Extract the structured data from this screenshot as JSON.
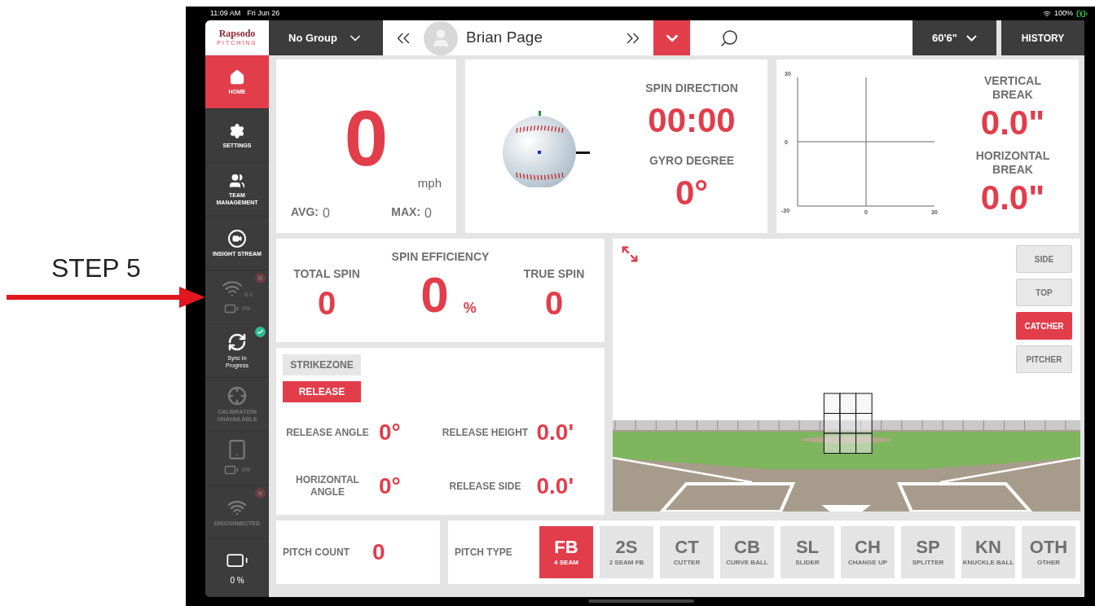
{
  "annotation": {
    "text": "STEP 5"
  },
  "status_bar": {
    "time": "11:09 AM",
    "date": "Fri Jun 26",
    "battery": "100%"
  },
  "sidebar": {
    "logo": {
      "title": "Rapsodo",
      "subtitle": "PITCHING"
    },
    "items": [
      {
        "kind": "nav",
        "label": "HOME",
        "selected": true,
        "disabled": false
      },
      {
        "kind": "nav",
        "label": "SETTINGS",
        "selected": false,
        "disabled": false
      },
      {
        "kind": "nav",
        "label": "TEAM MANAGEMENT",
        "selected": false,
        "disabled": false
      },
      {
        "kind": "nav",
        "label": "INSIGHT STREAM",
        "selected": false,
        "disabled": false
      },
      {
        "kind": "sensor",
        "reading": "0.0",
        "battery_reading": "0%",
        "connected": false,
        "selected": false,
        "disabled": true
      },
      {
        "kind": "sync",
        "label": "Sync In Progress",
        "connected": true,
        "selected": false,
        "disabled": false
      },
      {
        "kind": "calibration",
        "label": "CALIBRATION UNAVAILABLE",
        "selected": false,
        "disabled": true
      },
      {
        "kind": "device",
        "battery_reading": "0%",
        "selected": false,
        "disabled": true
      },
      {
        "kind": "connection",
        "label": "DISCONNECTED",
        "connected": false,
        "selected": false,
        "disabled": true
      },
      {
        "kind": "battery",
        "reading": "0 %",
        "selected": false,
        "disabled": false
      }
    ]
  },
  "top_bar": {
    "group_select": {
      "value": "No Group"
    },
    "player": {
      "name": "Brian Page"
    },
    "distance_select": {
      "value": "60'6\""
    },
    "history_button": {
      "label": "HISTORY"
    }
  },
  "speed": {
    "value": "0",
    "unit": "mph",
    "avg_label": "AVG:",
    "avg": "0",
    "max_label": "MAX:",
    "max": "0"
  },
  "spin": {
    "direction_label": "SPIN DIRECTION",
    "direction": "00:00",
    "gyro_label": "GYRO DEGREE",
    "gyro": "0°"
  },
  "break": {
    "vertical_label": "VERTICAL BREAK",
    "vertical": "0.0\"",
    "horizontal_label": "HORIZONTAL BREAK",
    "horizontal": "0.0\"",
    "chart_data": {
      "type": "scatter",
      "xlim": [
        -30,
        30
      ],
      "ylim": [
        -30,
        30
      ],
      "xticks": [
        0,
        30
      ],
      "yticks": [
        -30,
        0,
        30
      ]
    }
  },
  "spin_efficiency": {
    "title": "SPIN EFFICIENCY",
    "total_label": "TOTAL SPIN",
    "total": "0",
    "efficiency": "0",
    "efficiency_unit": "%",
    "true_label": "TRUE SPIN",
    "true": "0"
  },
  "release": {
    "tabs": [
      {
        "label": "STRIKEZONE",
        "selected": false
      },
      {
        "label": "RELEASE",
        "selected": true
      }
    ],
    "metrics": [
      {
        "label": "RELEASE ANGLE",
        "value": "0°"
      },
      {
        "label": "RELEASE HEIGHT",
        "value": "0.0'"
      },
      {
        "label": "HORIZONTAL ANGLE",
        "value": "0°"
      },
      {
        "label": "RELEASE SIDE",
        "value": "0.0'"
      }
    ]
  },
  "views": [
    {
      "label": "SIDE",
      "selected": false
    },
    {
      "label": "TOP",
      "selected": false
    },
    {
      "label": "CATCHER",
      "selected": true
    },
    {
      "label": "PITCHER",
      "selected": false
    }
  ],
  "pitch_count": {
    "label": "PITCH COUNT",
    "value": "0"
  },
  "pitch_type": {
    "label": "PITCH TYPE",
    "types": [
      {
        "code": "FB",
        "name": "4 SEAM",
        "selected": true
      },
      {
        "code": "2S",
        "name": "2 SEAM FB",
        "selected": false
      },
      {
        "code": "CT",
        "name": "CUTTER",
        "selected": false
      },
      {
        "code": "CB",
        "name": "CURVE BALL",
        "selected": false
      },
      {
        "code": "SL",
        "name": "SLIDER",
        "selected": false
      },
      {
        "code": "CH",
        "name": "CHANGE UP",
        "selected": false
      },
      {
        "code": "SP",
        "name": "SPLITTER",
        "selected": false
      },
      {
        "code": "KN",
        "name": "KNUCKLE BALL",
        "selected": false
      },
      {
        "code": "OTH",
        "name": "OTHER",
        "selected": false
      }
    ]
  }
}
